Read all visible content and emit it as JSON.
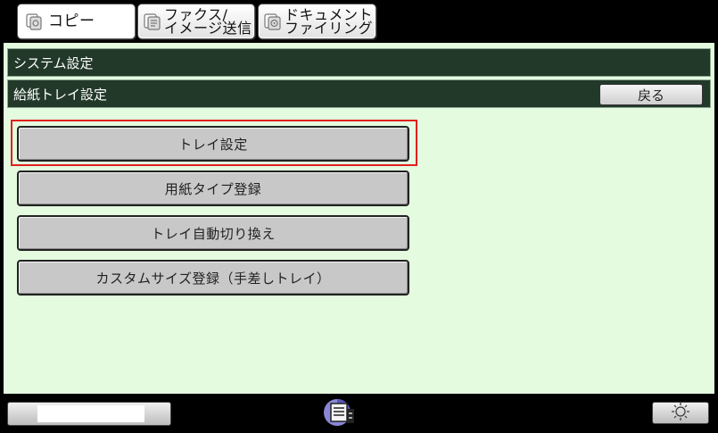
{
  "tabs": [
    {
      "label": "コピー"
    },
    {
      "label_line1": "ファクス/",
      "label_line2": "イメージ送信"
    },
    {
      "label_line1": "ドキュメント",
      "label_line2": "ファイリング"
    }
  ],
  "header": {
    "section_title": "システム設定",
    "page_title": "給紙トレイ設定",
    "back_label": "戻る"
  },
  "menu": {
    "items": [
      {
        "label": "トレイ設定"
      },
      {
        "label": "用紙タイプ登録"
      },
      {
        "label": "トレイ自動切り換え"
      },
      {
        "label": "カスタムサイズ登録（手差しトレイ）"
      }
    ]
  },
  "colors": {
    "panel_background": "#e4fbe0",
    "header_background": "#22392a",
    "highlight_border": "#e0201c",
    "button_gray": "#c8c8c8"
  },
  "icons": {
    "tab_copy": "copy-icon",
    "tab_fax": "fax-image-send-icon",
    "tab_document": "document-filing-icon",
    "machine": "machine-status-icon",
    "brightness": "brightness-sun-icon"
  }
}
